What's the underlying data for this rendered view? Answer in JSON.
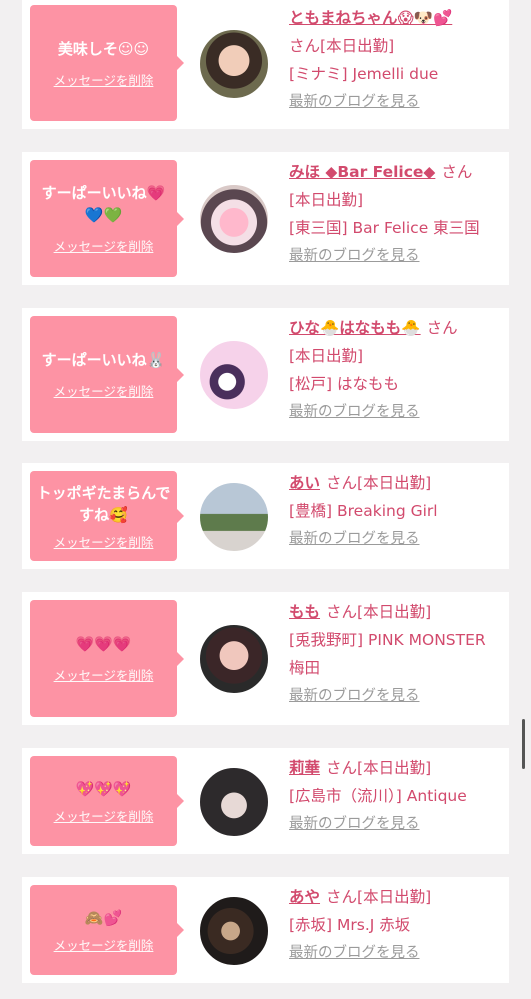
{
  "delete_label": "メッセージを削除",
  "blog_label": "最新のブログを見る",
  "san_label": "さん",
  "cards": [
    {
      "message": "美味しそ☺☺",
      "name": "ともまねちゃん😱🐶💕",
      "status": "[本日出勤]",
      "shop": "[ミナミ] Jemelli due",
      "inline_status": false
    },
    {
      "message": "すーぱーいいね💗💙💚",
      "name": "みほ ◆Bar Felice◆",
      "status": "[本日出勤]",
      "shop": "[東三国] Bar Felice 東三国",
      "inline_status": false
    },
    {
      "message": "すーぱーいいね🐰",
      "name": "ひな🐣はなもも🐣",
      "status": "[本日出勤]",
      "shop": "[松戸] はなもも",
      "inline_status": false
    },
    {
      "message": "トッポギたまらんですね🥰",
      "name": "あい",
      "status": "[本日出勤]",
      "shop": "[豊橋] Breaking Girl",
      "inline_status": true
    },
    {
      "message": "💗💗💗",
      "name": "もも",
      "status": "[本日出勤]",
      "shop": "[兎我野町] PINK MONSTER梅田",
      "inline_status": true
    },
    {
      "message": "💖💖💖",
      "name": "莉華",
      "status": "[本日出勤]",
      "shop": "[広島市（流川）] Antique",
      "inline_status": true
    },
    {
      "message": "🙈💕",
      "name": "あや",
      "status": "[本日出勤]",
      "shop": "[赤坂] Mrs.J 赤坂",
      "inline_status": true
    }
  ],
  "colors": {
    "accent": "#d24a6d",
    "bubble": "#fd93a4",
    "muted": "#9b9b9b"
  }
}
